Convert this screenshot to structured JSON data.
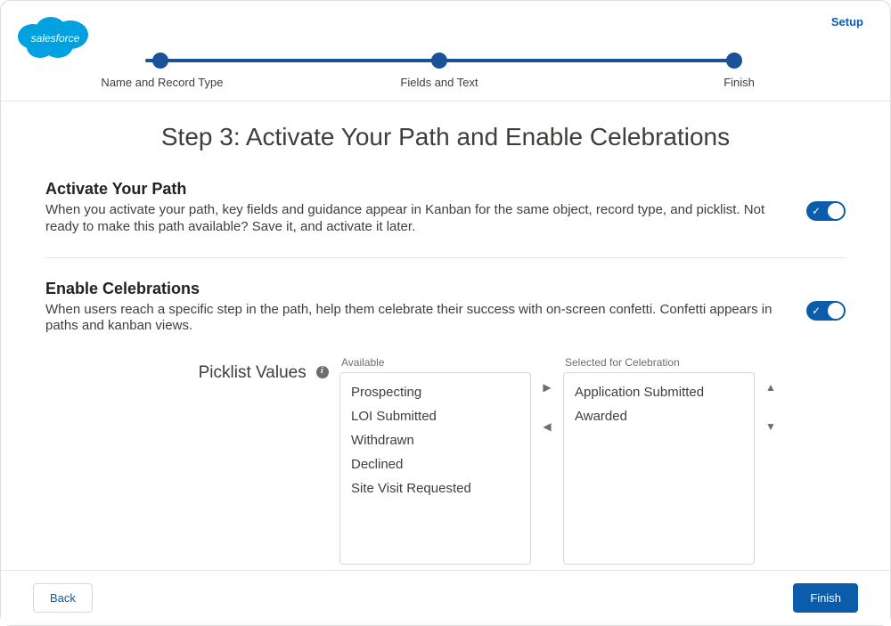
{
  "header": {
    "setup_link": "Setup"
  },
  "stepper": {
    "step1": "Name and Record Type",
    "step2": "Fields and Text",
    "step3": "Finish"
  },
  "page_title": "Step 3: Activate Your Path and Enable Celebrations",
  "activate": {
    "title": "Activate Your Path",
    "desc": "When you activate your path, key fields and guidance appear in Kanban for the same object, record type, and picklist. Not ready to make this path available? Save it, and activate it later.",
    "toggle_on": true
  },
  "celebrations": {
    "title": "Enable Celebrations",
    "desc": "When users reach a specific step in the path, help them celebrate their success with on-screen confetti. Confetti appears in paths and kanban views.",
    "toggle_on": true,
    "picklist_label": "Picklist Values",
    "available_label": "Available",
    "selected_label": "Selected for Celebration",
    "available": [
      "Prospecting",
      "LOI Submitted",
      "Withdrawn",
      "Declined",
      "Site Visit Requested"
    ],
    "selected": [
      "Application Submitted",
      "Awarded"
    ]
  },
  "footer": {
    "back": "Back",
    "finish": "Finish"
  }
}
